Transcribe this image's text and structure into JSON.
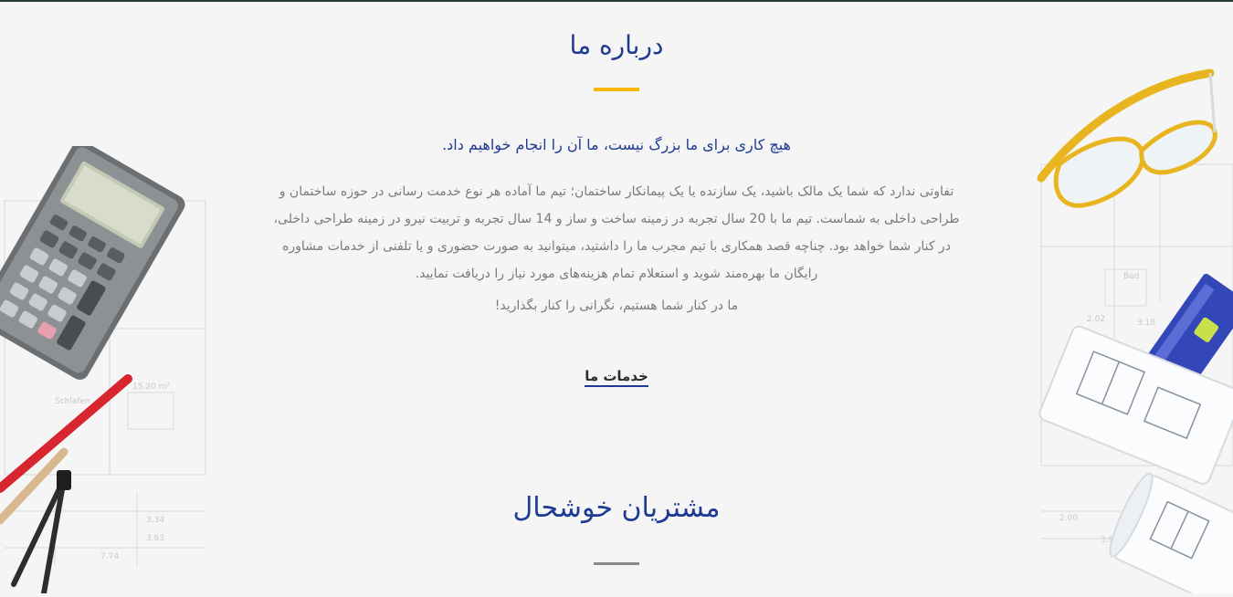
{
  "about": {
    "title": "درباره ما",
    "tagline": "هیچ کاری برای ما بزرگ نیست، ما آن را انجام خواهیم داد.",
    "body": "تفاوتی ندارد که شما یک مالک باشید، یک سازنده یا یک پیمانکار ساختمان؛ تیم ما آماده هر نوع خدمت رسانی در حوزه ساختمان و طراحی داخلی به شماست. تیم ما با 20 سال تجربه در زمینه ساخت و ساز و 14 سال تجربه و تربیت نیرو در زمینه طراحی داخلی، در کنار شما خواهد بود. چناچه قصد همکاری با تیم مجرب ما را داشتید، میتوانید به صورت حضوری و یا تلفنی از خدمات مشاوره رایگان ما بهره‌مند شوید و استعلام تمام هزینه‌های مورد نیاز را دریافت نمایید.",
    "closing": "ما در کنار شما هستیم، نگرانی را کنار بگذارید!",
    "services_link": "خدمات ما",
    "accent_color": "#f6b800",
    "title_color": "#1f3a93"
  },
  "clients": {
    "title": "مشتریان خوشحال"
  },
  "decor": {
    "left_image": "calculator-pencils-compass-blueprint",
    "right_image": "safety-glasses-level-blueprint-rolls"
  }
}
